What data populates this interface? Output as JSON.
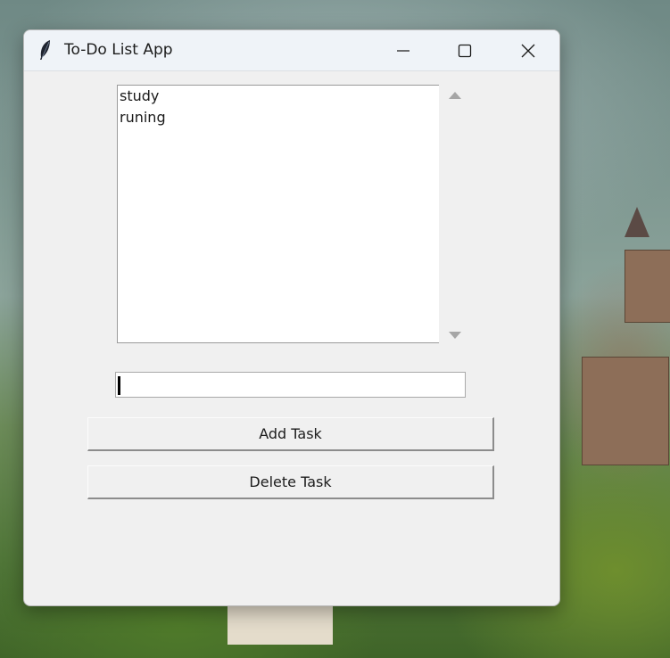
{
  "window": {
    "title": "To-Do List App",
    "icon": "feather-icon",
    "controls": [
      "minimize-icon",
      "maximize-icon",
      "close-icon"
    ]
  },
  "tasks": {
    "items": [
      "study",
      "runing"
    ]
  },
  "task_entry": {
    "value": ""
  },
  "buttons": {
    "add_label": "Add Task",
    "delete_label": "Delete Task"
  },
  "colors": {
    "window_bg": "#f0f0f0",
    "titlebar_bg": "#eff3f8",
    "listbox_bg": "#ffffff"
  }
}
